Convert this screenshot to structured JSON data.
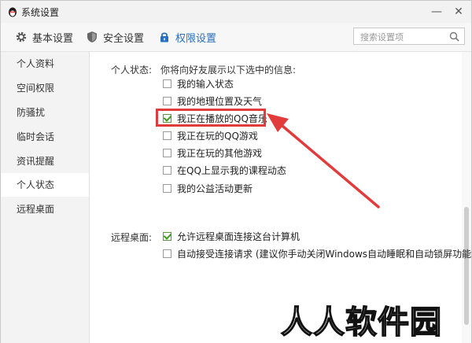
{
  "window": {
    "title": "系统设置",
    "minimize_label": "—",
    "close_label": "✕"
  },
  "toolbar": {
    "tabs": [
      {
        "label": "基本设置",
        "icon": "gear-icon"
      },
      {
        "label": "安全设置",
        "icon": "shield-icon"
      },
      {
        "label": "权限设置",
        "icon": "lock-icon"
      }
    ],
    "search_placeholder": "搜索设置项"
  },
  "sidebar": {
    "items": [
      {
        "label": "个人资料"
      },
      {
        "label": "空间权限"
      },
      {
        "label": "防骚扰"
      },
      {
        "label": "临时会话"
      },
      {
        "label": "资讯提醒"
      },
      {
        "label": "个人状态"
      },
      {
        "label": "远程桌面"
      }
    ],
    "active": "个人状态"
  },
  "personal_status": {
    "label": "个人状态:",
    "description": "你将向好友展示以下选中的信息:",
    "options": [
      {
        "label": "我的输入状态",
        "checked": false
      },
      {
        "label": "我的地理位置及天气",
        "checked": false
      },
      {
        "label": "我正在播放的QQ音乐",
        "checked": true
      },
      {
        "label": "我正在玩的QQ游戏",
        "checked": false
      },
      {
        "label": "我正在玩的其他游戏",
        "checked": false
      },
      {
        "label": "在QQ上显示我的课程动态",
        "checked": false
      },
      {
        "label": "我的公益活动更新",
        "checked": false
      }
    ]
  },
  "remote_desktop": {
    "label": "远程桌面:",
    "options": [
      {
        "label": "允许远程桌面连接这台计算机",
        "checked": true
      },
      {
        "label": "自动接受连接请求 (建议你手动关闭Windows自动睡眠和自动锁屏功能)",
        "checked": false
      }
    ]
  },
  "watermark": "人人软件园",
  "colors": {
    "accent": "#2a6fb8",
    "highlight": "#e23b3b",
    "check": "#3a9a1a"
  }
}
